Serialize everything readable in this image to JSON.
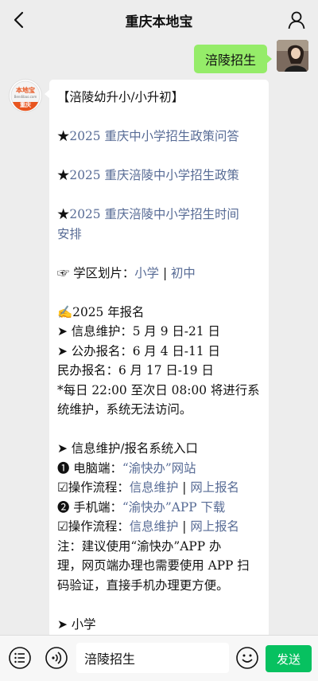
{
  "header": {
    "title": "重庆本地宝",
    "back_icon": "chevron-left-icon",
    "user_icon": "user-icon"
  },
  "my_message": {
    "text": "涪陵招生"
  },
  "bot": {
    "avatar_text_top": "本地宝",
    "avatar_text_mid": "Bendibao.com",
    "avatar_text_bottom": "重庆",
    "lines": {
      "title": "【涪陵幼升小/小升初】",
      "star1_mark": "★",
      "star1_link": "2025 重庆中小学招生政策问答",
      "star2_mark": "★",
      "star2_link": "2025 重庆涪陵中小学招生政策",
      "star3_mark": "★",
      "star3_link_a": "2025 重庆涪陵中小学招生时间",
      "star3_link_b": "安排",
      "district_prefix": "☞ 学区划片：",
      "district_link1": "小学",
      "district_sep": " | ",
      "district_link2": "初中",
      "reg_title": "✍2025 年报名",
      "reg1": "➤ 信息维护：5 月 9 日-21 日",
      "reg2": "➤ 公办报名：6 月 4 日-11 日",
      "reg3": "民办报名：6 月 17 日-19 日",
      "reg4a": "*每日 22:00 至次日 08:00 将进行系",
      "reg4b": "统维护，系统无法访问。",
      "entry_title": "➤ 信息维护/报名系统入口",
      "pc_prefix": "❶ 电脑端：",
      "pc_link": "“渝快办”网站",
      "op1_prefix": "☑操作流程：",
      "op1_link1": "信息维护",
      "op1_sep": " | ",
      "op1_link2": "网上报名",
      "mobile_prefix": "❷ 手机端：",
      "mobile_link": "“渝快办”APP 下载",
      "op2_prefix": "☑操作流程：",
      "op2_link1": "信息维护",
      "op2_sep": " | ",
      "op2_link2": "网上报名",
      "note_a": "注：建议使用“渝快办”APP 办",
      "note_b": "理，网页端办理也需要使用 APP 扫",
      "note_c": "码验证，直接手机办理更方便。",
      "primary": "➤ 小学"
    }
  },
  "input": {
    "value": "涪陵招生"
  },
  "send_label": "发送",
  "colors": {
    "send": "#07c160",
    "my_bubble": "#95ec69",
    "link": "#576b95"
  }
}
